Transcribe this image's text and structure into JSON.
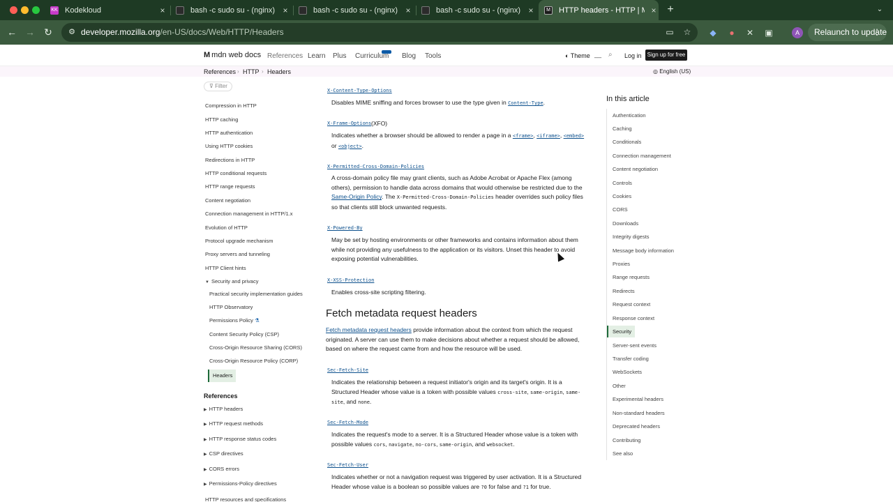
{
  "browser": {
    "tabs": [
      {
        "title": "Kodekloud",
        "favicon": "KK",
        "favicon_color": "#c63bc9"
      },
      {
        "title": "bash -c sudo su - (nginx)",
        "favicon": "",
        "favicon_color": "#2b2b2b"
      },
      {
        "title": "bash -c sudo su - (nginx)",
        "favicon": "",
        "favicon_color": "#2b2b2b"
      },
      {
        "title": "bash -c sudo su - (nginx)",
        "favicon": "",
        "favicon_color": "#2b2b2b"
      },
      {
        "title": "HTTP headers - HTTP | MDN",
        "favicon": "M",
        "favicon_color": "#1b1b1b"
      }
    ],
    "close_glyph": "×",
    "new_tab_glyph": "+",
    "tab_menu_glyph": "⌄",
    "url_host": "developer.mozilla.org",
    "url_path": "/en-US/docs/Web/HTTP/Headers",
    "relaunch_label": "Relaunch to update",
    "profile_initial": "A",
    "colors": {
      "tabstrip": "#1e3a24",
      "toolbar": "#3b5a3e"
    }
  },
  "mdn": {
    "logo_text": "mdn web docs",
    "logo_mark": "M",
    "nav": [
      "References",
      "Learn",
      "Plus",
      "Curriculum",
      "Blog",
      "Tools"
    ],
    "theme_label": "Theme",
    "search_placeholder": "__",
    "login_label": "Log in",
    "signup_label": "Sign up for free",
    "breadcrumbs": [
      "References",
      "HTTP",
      "Headers"
    ],
    "language": "English (US)"
  },
  "sidebar": {
    "filter_placeholder": "Filter",
    "items": [
      "Compression in HTTP",
      "HTTP caching",
      "HTTP authentication",
      "Using HTTP cookies",
      "Redirections in HTTP",
      "HTTP conditional requests",
      "HTTP range requests",
      "Content negotiation",
      "Connection management in HTTP/1.x",
      "Evolution of HTTP",
      "Protocol upgrade mechanism",
      "Proxy servers and tunneling",
      "HTTP Client hints"
    ],
    "security_group": "Security and privacy",
    "security_items": [
      "Practical security implementation guides",
      "HTTP Observatory",
      "Permissions Policy",
      "Content Security Policy (CSP)",
      "Cross-Origin Resource Sharing (CORS)",
      "Cross-Origin Resource Policy (CORP)"
    ],
    "current": "Headers",
    "references_heading": "References",
    "references": [
      "HTTP headers",
      "HTTP request methods",
      "HTTP response status codes",
      "CSP directives",
      "CORS errors",
      "Permissions-Policy directives"
    ],
    "last_item": "HTTP resources and specifications"
  },
  "content": {
    "xcto": {
      "name": "X-Content-Type-Options",
      "text": "Disables MIME sniffing and forces browser to use the type given in",
      "code": "Content-Type",
      "end": "."
    },
    "xfo": {
      "name": "X-Frame-Options",
      "suffix": "(XFO)",
      "text": "Indicates whether a browser should be allowed to render a page in a",
      "c1": "<frame>",
      "c2": "<iframe>",
      "c3": "<embed>",
      "or": "or",
      "c4": "<object>"
    },
    "xpcdp": {
      "name": "X-Permitted-Cross-Domain-Policies",
      "t1": "A cross-domain policy file may grant clients, such as Adobe Acrobat or Apache Flex (among others), permission to handle data across domains that would otherwise be restricted due to the",
      "link": "Same-Origin Policy",
      "t2": ". The",
      "code": "X-Permitted-Cross-Domain-Policies",
      "t3": "header overrides such policy files so that clients still block unwanted requests."
    },
    "xpb": {
      "name": "X-Powered-By",
      "text": "May be set by hosting environments or other frameworks and contains information about them while not providing any usefulness to the application or its visitors. Unset this header to avoid exposing potential vulnerabilities."
    },
    "xxss": {
      "name": "X-XSS-Protection",
      "text": "Enables cross-site scripting filtering."
    },
    "fetch_heading": "Fetch metadata request headers",
    "fetch_intro": {
      "link": "Fetch metadata request headers",
      "text": "provide information about the context from which the request originated. A server can use them to make decisions about whether a request should be allowed, based on where the request came from and how the resource will be used."
    },
    "sfs": {
      "name": "Sec-Fetch-Site",
      "text": "Indicates the relationship between a request initiator's origin and its target's origin. It is a Structured Header whose value is a token with possible values",
      "v1": "cross-site",
      "v2": "same-origin",
      "v3": "same-site",
      "and": ", and",
      "v4": "none",
      "end": "."
    },
    "sfm": {
      "name": "Sec-Fetch-Mode",
      "text": "Indicates the request's mode to a server. It is a Structured Header whose value is a token with possible values",
      "v1": "cors",
      "v2": "navigate",
      "v3": "no-cors",
      "v4": "same-origin",
      "and": ", and",
      "v5": "websocket",
      "end": "."
    },
    "sfu": {
      "name": "Sec-Fetch-User",
      "text": "Indicates whether or not a navigation request was triggered by user activation. It is a Structured Header whose value is a boolean so possible values are",
      "v1": "?0",
      "mid": "for false and",
      "v2": "?1",
      "end": "for true."
    }
  },
  "toc": {
    "title": "In this article",
    "items": [
      "Authentication",
      "Caching",
      "Conditionals",
      "Connection management",
      "Content negotiation",
      "Controls",
      "Cookies",
      "CORS",
      "Downloads",
      "Integrity digests",
      "Message body information",
      "Proxies",
      "Range requests",
      "Redirects",
      "Request context",
      "Response context",
      "Security",
      "Server-sent events",
      "Transfer coding",
      "WebSockets",
      "Other",
      "Experimental headers",
      "Non-standard headers",
      "Deprecated headers",
      "Contributing",
      "See also"
    ],
    "active": "Security"
  }
}
